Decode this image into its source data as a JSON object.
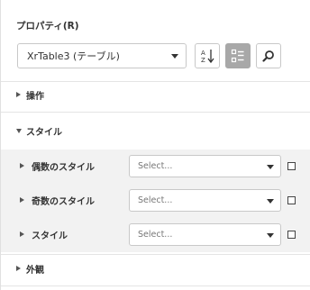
{
  "panel": {
    "title": "プロパティ(R)",
    "object_selector": {
      "value": "XrTable3 (テーブル)"
    },
    "toolbar": {
      "sort_icon": "sort-alphabetical-icon",
      "categorized_icon": "categorized-view-icon",
      "search_icon": "search-icon"
    }
  },
  "sections": {
    "actions": {
      "label": "操作",
      "expanded": false
    },
    "styles": {
      "label": "スタイル",
      "expanded": true
    },
    "appearance": {
      "label": "外観",
      "expanded": false
    }
  },
  "style_properties": [
    {
      "label": "偶数のスタイル",
      "placeholder": "Select..."
    },
    {
      "label": "奇数のスタイル",
      "placeholder": "Select..."
    },
    {
      "label": "スタイル",
      "placeholder": "Select..."
    }
  ],
  "colors": {
    "active_button": "#a8a8a8",
    "group_background": "#f2f2f2"
  }
}
